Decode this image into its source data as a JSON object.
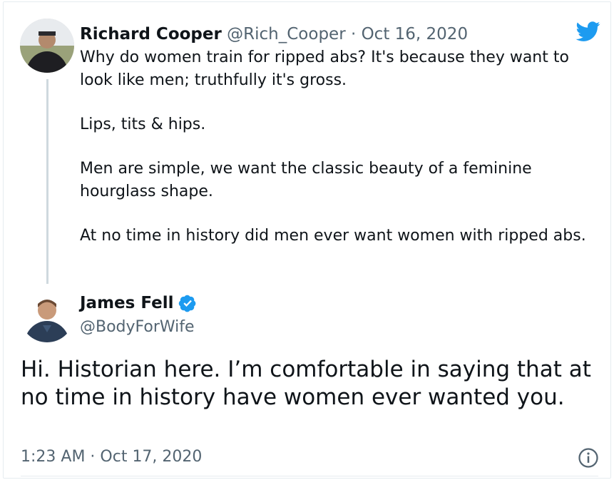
{
  "colors": {
    "twitter_blue": "#1d9bf0",
    "text_primary": "#0f1419",
    "text_secondary": "#536471",
    "thread_line": "#cfd9de"
  },
  "icons": {
    "brand": "twitter-bird-icon",
    "verified": "verified-badge-icon",
    "info": "info-icon"
  },
  "quoted_tweet": {
    "display_name": "Richard Cooper",
    "meta": "@Rich_Cooper · Oct 16, 2020",
    "paragraphs": [
      "Why do women train for ripped abs?  It's because they want to look like men; truthfully it's gross.",
      "Lips, tits & hips.",
      "Men are simple, we want the classic beauty of a feminine hourglass shape.",
      "At no time in history did men ever want women with ripped abs."
    ]
  },
  "tweet": {
    "display_name": "James Fell",
    "handle": "@BodyForWife",
    "text": "Hi. Historian here. I’m comfortable in saying that at no time in history have women ever wanted you.",
    "timestamp": "1:23 AM · Oct 17, 2020"
  }
}
